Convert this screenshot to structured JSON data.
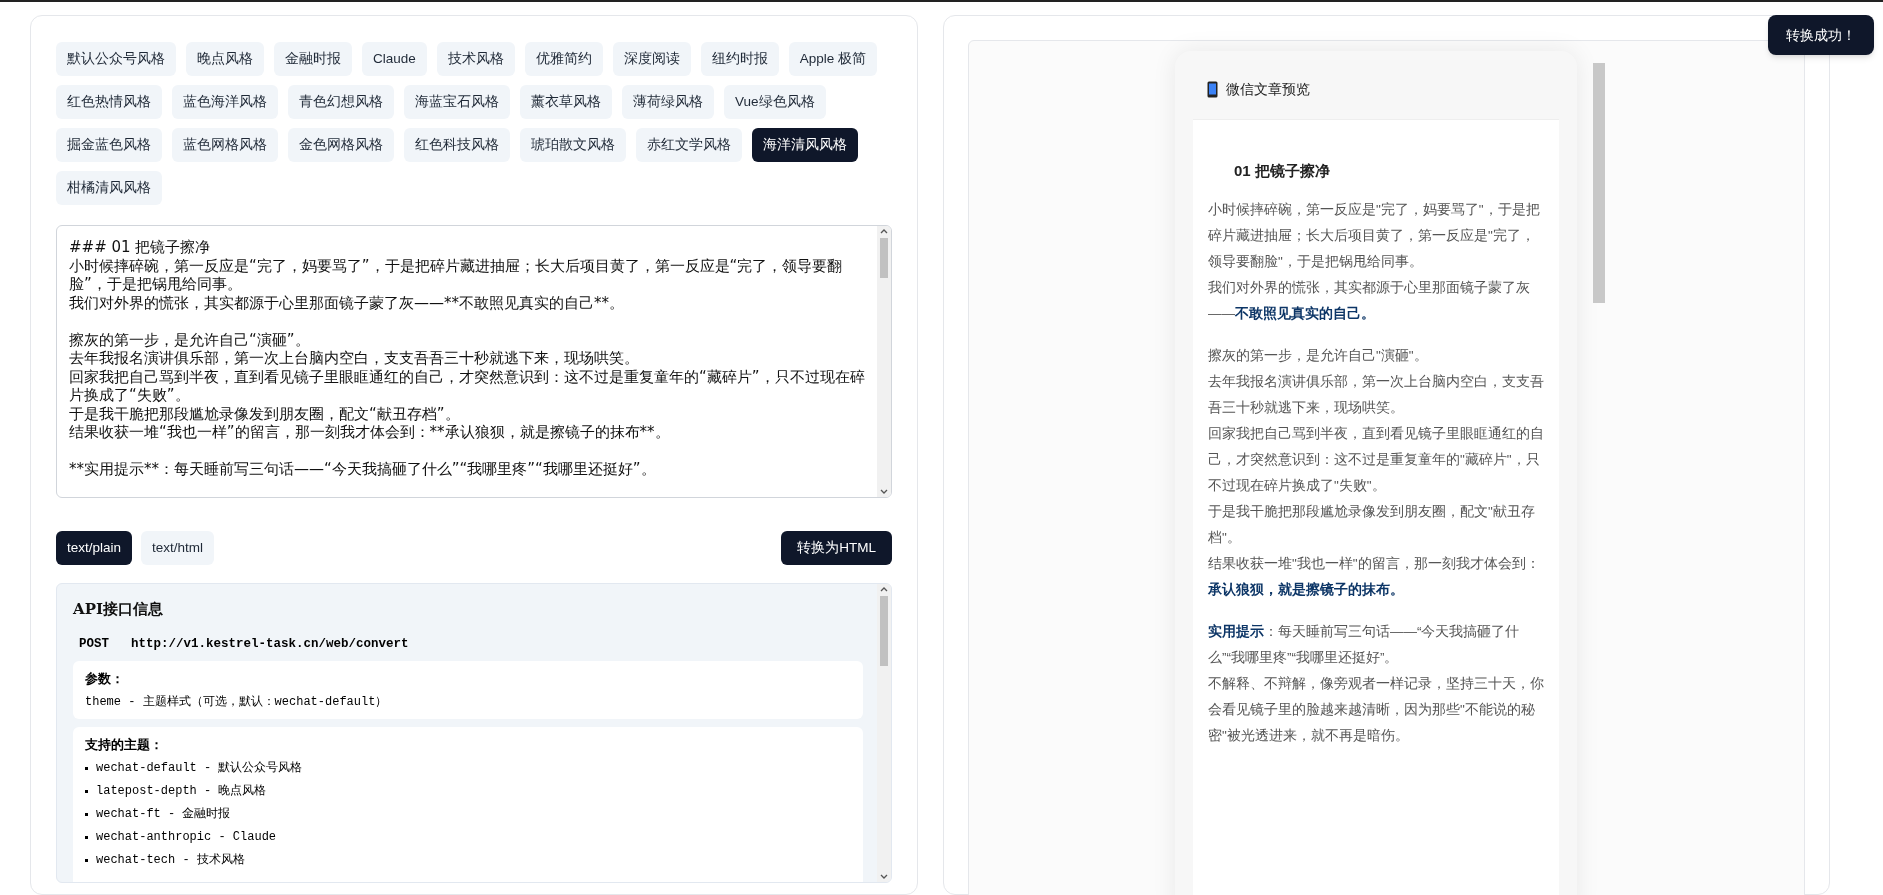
{
  "themes": [
    {
      "label": "默认公众号风格",
      "selected": false
    },
    {
      "label": "晚点风格",
      "selected": false
    },
    {
      "label": "金融时报",
      "selected": false
    },
    {
      "label": "Claude",
      "selected": false
    },
    {
      "label": "技术风格",
      "selected": false
    },
    {
      "label": "优雅简约",
      "selected": false
    },
    {
      "label": "深度阅读",
      "selected": false
    },
    {
      "label": "纽约时报",
      "selected": false
    },
    {
      "label": "Apple 极简",
      "selected": false
    },
    {
      "label": "红色热情风格",
      "selected": false
    },
    {
      "label": "蓝色海洋风格",
      "selected": false
    },
    {
      "label": "青色幻想风格",
      "selected": false
    },
    {
      "label": "海蓝宝石风格",
      "selected": false
    },
    {
      "label": "薰衣草风格",
      "selected": false
    },
    {
      "label": "薄荷绿风格",
      "selected": false
    },
    {
      "label": "Vue绿色风格",
      "selected": false
    },
    {
      "label": "掘金蓝色风格",
      "selected": false
    },
    {
      "label": "蓝色网格风格",
      "selected": false
    },
    {
      "label": "金色网格风格",
      "selected": false
    },
    {
      "label": "红色科技风格",
      "selected": false
    },
    {
      "label": "琥珀散文风格",
      "selected": false
    },
    {
      "label": "赤红文学风格",
      "selected": false
    },
    {
      "label": "海洋清风风格",
      "selected": true
    },
    {
      "label": "柑橘清风风格",
      "selected": false
    }
  ],
  "editor": {
    "paragraphs": [
      [
        "### 01 把镜子擦净",
        "小时候摔碎碗，第一反应是“完了，妈要骂了”，于是把碎片藏进抽屉；长大后项目黄了，第一反应是“完了，领导要翻脸”，于是把锅甩给同事。",
        "我们对外界的慌张，其实都源于心里那面镜子蒙了灰——**不敢照见真实的自己**。"
      ],
      [
        "擦灰的第一步，是允许自己“演砸”。",
        "去年我报名演讲俱乐部，第一次上台脑内空白，支支吾吾三十秒就逃下来，现场哄笑。",
        "回家我把自己骂到半夜，直到看见镜子里眼眶通红的自己，才突然意识到：这不过是重复童年的“藏碎片”，只不过现在碎片换成了“失败”。",
        "于是我干脆把那段尴尬录像发到朋友圈，配文“献丑存档”。",
        "结果收获一堆“我也一样”的留言，那一刻我才体会到：**承认狼狈，就是擦镜子的抹布**。"
      ],
      [
        "**实用提示**：每天睡前写三句话——“今天我搞砸了什么”“我哪里疼”“我哪里还挺好”。"
      ]
    ]
  },
  "formats": [
    {
      "label": "text/plain",
      "selected": true
    },
    {
      "label": "text/html",
      "selected": false
    }
  ],
  "convert_button": "转换为HTML",
  "api": {
    "title": "API接口信息",
    "method": "POST",
    "url": "http://v1.kestrel-task.cn/web/convert",
    "params_title": "参数：",
    "params": [
      "theme - 主题样式（可选，默认：wechat-default）"
    ],
    "themes_title": "支持的主题：",
    "theme_list": [
      "wechat-default - 默认公众号风格",
      "latepost-depth - 晚点风格",
      "wechat-ft - 金融时报",
      "wechat-anthropic - Claude",
      "wechat-tech - 技术风格"
    ]
  },
  "preview": {
    "title": "微信文章预览",
    "heading": "01 把镜子擦净",
    "paragraphs": [
      [
        "小时候摔碎碗，第一反应是\"完了，妈要骂了\"，于是把碎片藏进抽屉；长大后项目黄了，第一反应是\"完了，领导要翻脸\"，于是把锅甩给同事。",
        "我们对外界的慌张，其实都源于心里那面镜子蒙了灰——**不敢照见真实的自己。**"
      ],
      [
        "擦灰的第一步，是允许自己\"演砸\"。",
        "去年我报名演讲俱乐部，第一次上台脑内空白，支支吾吾三十秒就逃下来，现场哄笑。",
        "回家我把自己骂到半夜，直到看见镜子里眼眶通红的自己，才突然意识到：这不过是重复童年的\"藏碎片\"，只不过现在碎片换成了\"失败\"。",
        "于是我干脆把那段尴尬录像发到朋友圈，配文\"献丑存档\"。",
        "结果收获一堆\"我也一样\"的留言，那一刻我才体会到：**承认狼狈，就是擦镜子的抹布。**"
      ],
      [
        "**实用提示**：每天睡前写三句话——“今天我搞砸了什么”“我哪里疼”“我哪里还挺好”。",
        "不解释、不辩解，像旁观者一样记录，坚持三十天，你会看见镜子里的脸越来越清晰，因为那些\"不能说的秘密\"被光透进来，就不再是暗伤。"
      ]
    ]
  },
  "toast": "转换成功！"
}
